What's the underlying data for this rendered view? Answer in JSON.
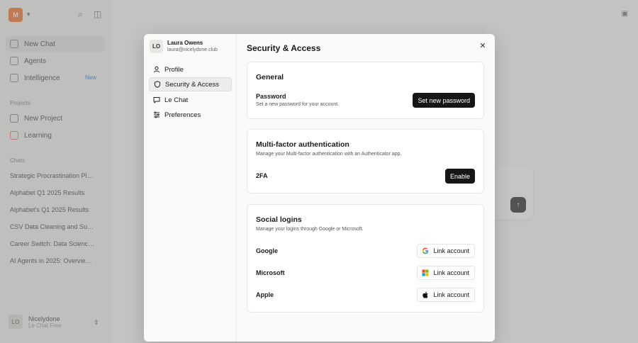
{
  "background": {
    "logo_text": "M",
    "nav": [
      {
        "label": "New Chat"
      },
      {
        "label": "Agents"
      },
      {
        "label": "Intelligence",
        "badge": "New"
      }
    ],
    "projects_title": "Projects",
    "projects": [
      {
        "label": "New Project"
      },
      {
        "label": "Learning"
      }
    ],
    "chats_title": "Chats",
    "chats": [
      "Strategic Procrastination Pla…",
      "Alphabet Q1 2025 Results",
      "Alphabet's Q1 2025 Results",
      "CSV Data Cleaning and Sum…",
      "Career Switch: Data Science…",
      "AI Agents in 2025: Overview…"
    ],
    "user_initials": "LO",
    "user_name": "Nicelydone",
    "user_plan": "Le Chat Free"
  },
  "modal": {
    "user": {
      "initials": "LO",
      "name": "Laura Owens",
      "email": "laura@nicelydone.club"
    },
    "nav": [
      {
        "label": "Profile",
        "icon": "user-icon"
      },
      {
        "label": "Security & Access",
        "icon": "shield-icon",
        "active": true
      },
      {
        "label": "Le Chat",
        "icon": "chat-icon"
      },
      {
        "label": "Preferences",
        "icon": "sliders-icon"
      }
    ],
    "title": "Security & Access",
    "general": {
      "heading": "General",
      "password_label": "Password",
      "password_desc": "Set a new password for your account.",
      "password_button": "Set new password"
    },
    "mfa": {
      "heading": "Multi-factor authentication",
      "desc": "Manage your Multi-factor authentication with an Authenticator app.",
      "twofa_label": "2FA",
      "enable_button": "Enable"
    },
    "social": {
      "heading": "Social logins",
      "desc": "Manage your logins through Google or Microsoft.",
      "providers": [
        {
          "name": "Google",
          "button": "Link account",
          "icon": "google-icon"
        },
        {
          "name": "Microsoft",
          "button": "Link account",
          "icon": "microsoft-icon"
        },
        {
          "name": "Apple",
          "button": "Link account",
          "icon": "apple-icon"
        }
      ]
    }
  },
  "colors": {
    "accent_orange": "#f26b1d",
    "button_dark": "#161616",
    "new_badge": "#2d6be4"
  }
}
